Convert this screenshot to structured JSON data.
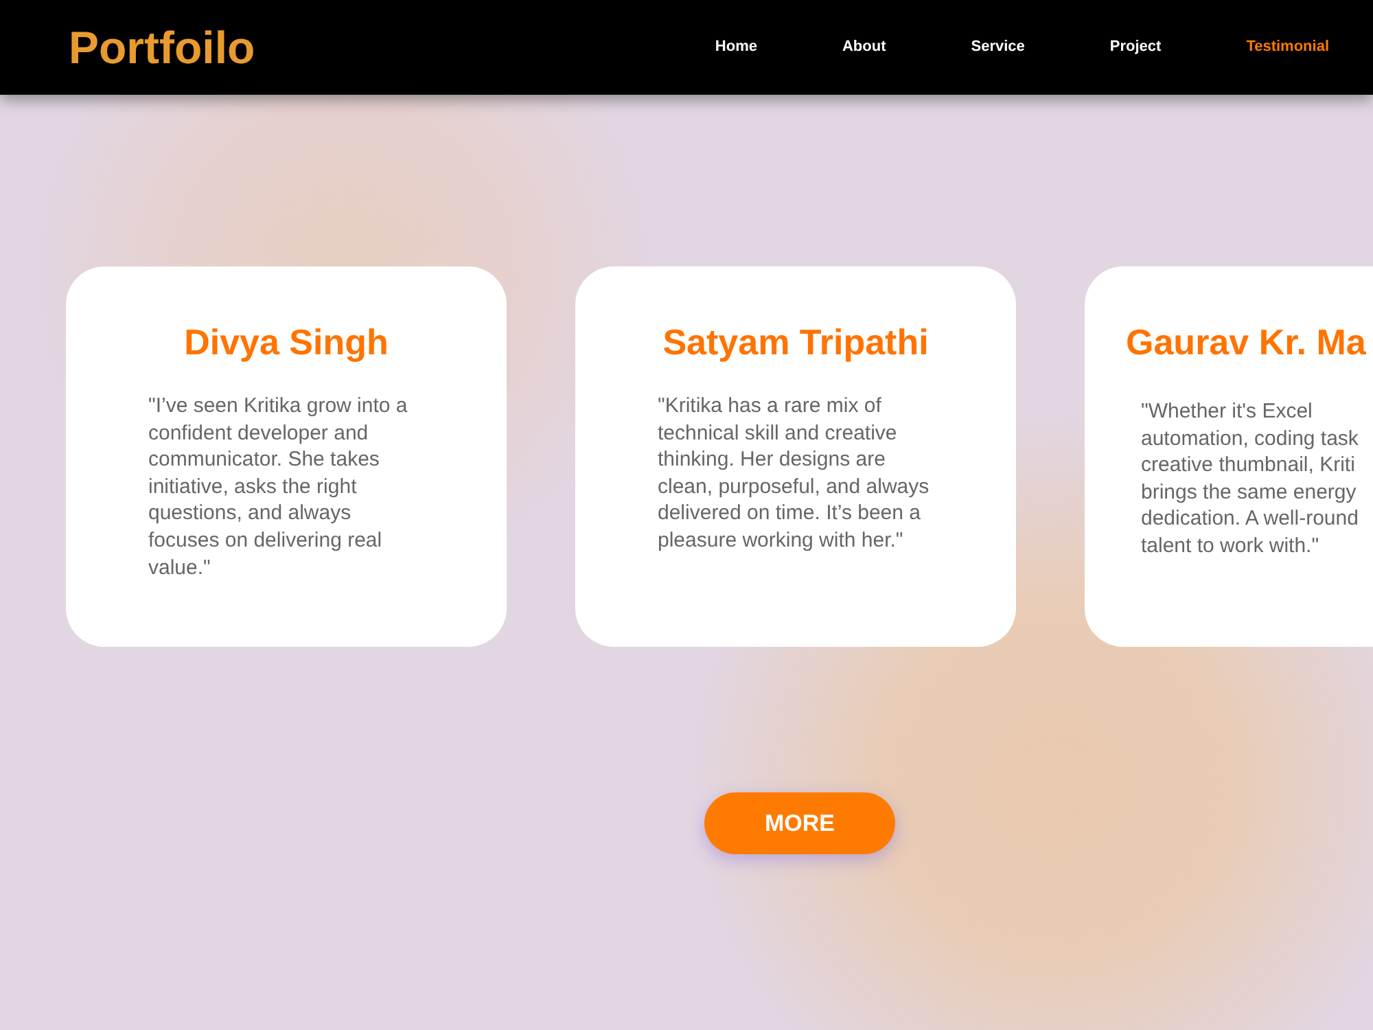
{
  "header": {
    "logo": "Portfoilo",
    "nav": [
      {
        "label": "Home",
        "selected": false
      },
      {
        "label": "About",
        "selected": false
      },
      {
        "label": "Service",
        "selected": false
      },
      {
        "label": "Project",
        "selected": false
      },
      {
        "label": "Testimonial",
        "selected": true
      }
    ]
  },
  "testimonials": [
    {
      "name": "Divya Singh",
      "quote": "\"I’ve seen Kritika grow into a confident developer and communicator. She takes initiative, asks the right questions, and always focuses on delivering real value.\"",
      "cut_off": false
    },
    {
      "name": "Satyam Tripathi",
      "quote": "\"Kritika has a rare mix of technical skill and creative thinking. Her designs are clean, purposeful, and always delivered on time. It’s been a pleasure working with her.\"",
      "cut_off": false
    },
    {
      "name": "Gaurav Kr. Ma",
      "quote": "\"Whether it's Excel\nautomation, coding task\ncreative thumbnail, Kriti\nbrings the same energy\ndedication. A well-round\ntalent to work with.\"",
      "cut_off": true
    }
  ],
  "more_button": "MORE"
}
